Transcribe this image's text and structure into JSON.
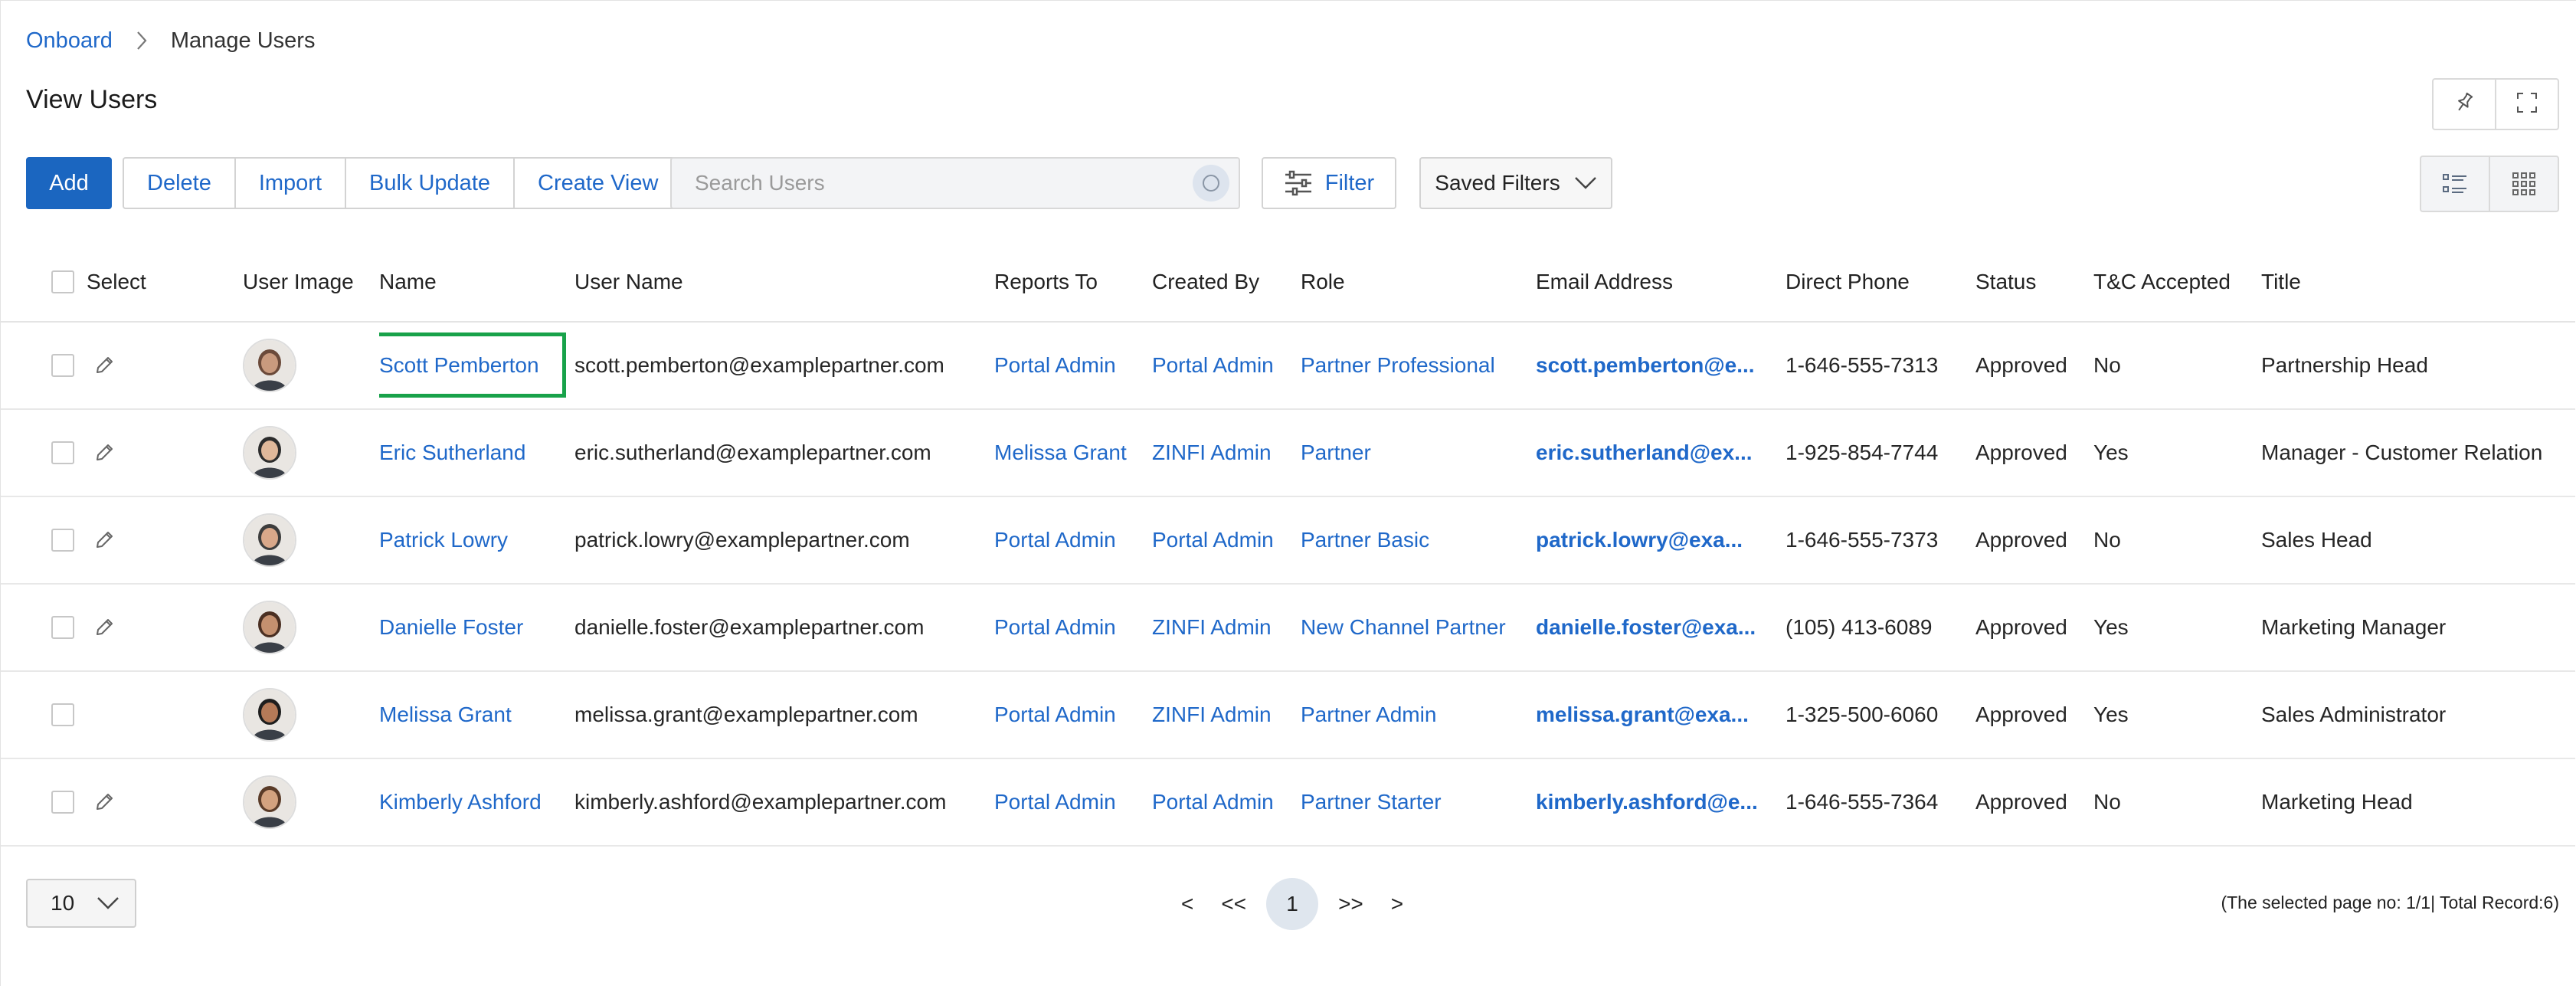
{
  "breadcrumb": {
    "root": "Onboard",
    "current": "Manage Users"
  },
  "page": {
    "title": "View Users"
  },
  "toolbar": {
    "add": "Add",
    "actions": [
      "Delete",
      "Import",
      "Bulk Update",
      "Create View"
    ],
    "search_placeholder": "Search Users",
    "filter": "Filter",
    "saved_filters": "Saved Filters"
  },
  "icons": {
    "pin": "pin-icon",
    "expand": "expand-icon",
    "search": "search-icon",
    "filter": "sliders-icon",
    "list_view": "list-view-icon",
    "grid_view": "grid-view-icon",
    "edit": "pencil-icon"
  },
  "colors": {
    "primary": "#1b66c0",
    "link": "#1f68c9",
    "highlight": "#18a24a"
  },
  "table": {
    "columns": [
      "Select",
      "User Image",
      "Name",
      "User Name",
      "Reports To",
      "Created By",
      "Role",
      "Email Address",
      "Direct Phone",
      "Status",
      "T&C Accepted",
      "Title"
    ],
    "rows": [
      {
        "name": "Scott Pemberton",
        "username": "scott.pemberton@examplepartner.com",
        "reports_to": "Portal Admin",
        "created_by": "Portal Admin",
        "role": "Partner Professional",
        "email": "scott.pemberton@e...",
        "phone": "1-646-555-7313",
        "status": "Approved",
        "tc": "No",
        "title": "Partnership Head",
        "editable": true,
        "highlighted": true
      },
      {
        "name": "Eric Sutherland",
        "username": "eric.sutherland@examplepartner.com",
        "reports_to": "Melissa Grant",
        "created_by": "ZINFI Admin",
        "role": "Partner",
        "email": "eric.sutherland@ex...",
        "phone": "1-925-854-7744",
        "status": "Approved",
        "tc": "Yes",
        "title": "Manager - Customer Relation",
        "editable": true,
        "highlighted": false
      },
      {
        "name": "Patrick Lowry",
        "username": "patrick.lowry@examplepartner.com",
        "reports_to": "Portal Admin",
        "created_by": "Portal Admin",
        "role": "Partner Basic",
        "email": "patrick.lowry@exa...",
        "phone": "1-646-555-7373",
        "status": "Approved",
        "tc": "No",
        "title": "Sales Head",
        "editable": true,
        "highlighted": false
      },
      {
        "name": "Danielle Foster",
        "username": "danielle.foster@examplepartner.com",
        "reports_to": "Portal Admin",
        "created_by": "ZINFI Admin",
        "role": "New Channel Partner",
        "email": "danielle.foster@exa...",
        "phone": "(105) 413-6089",
        "status": "Approved",
        "tc": "Yes",
        "title": "Marketing Manager",
        "editable": true,
        "highlighted": false
      },
      {
        "name": "Melissa Grant",
        "username": "melissa.grant@examplepartner.com",
        "reports_to": "Portal Admin",
        "created_by": "ZINFI Admin",
        "role": "Partner Admin",
        "email": "melissa.grant@exa...",
        "phone": "1-325-500-6060",
        "status": "Approved",
        "tc": "Yes",
        "title": "Sales Administrator",
        "editable": false,
        "highlighted": false
      },
      {
        "name": "Kimberly Ashford",
        "username": "kimberly.ashford@examplepartner.com",
        "reports_to": "Portal Admin",
        "created_by": "Portal Admin",
        "role": "Partner Starter",
        "email": "kimberly.ashford@e...",
        "phone": "1-646-555-7364",
        "status": "Approved",
        "tc": "No",
        "title": "Marketing Head",
        "editable": true,
        "highlighted": false
      }
    ]
  },
  "pagination": {
    "page_size": "10",
    "prev": "<",
    "first": "<<",
    "current": "1",
    "last": ">>",
    "next": ">",
    "summary": "(The selected page no: 1/1| Total Record:6)"
  }
}
